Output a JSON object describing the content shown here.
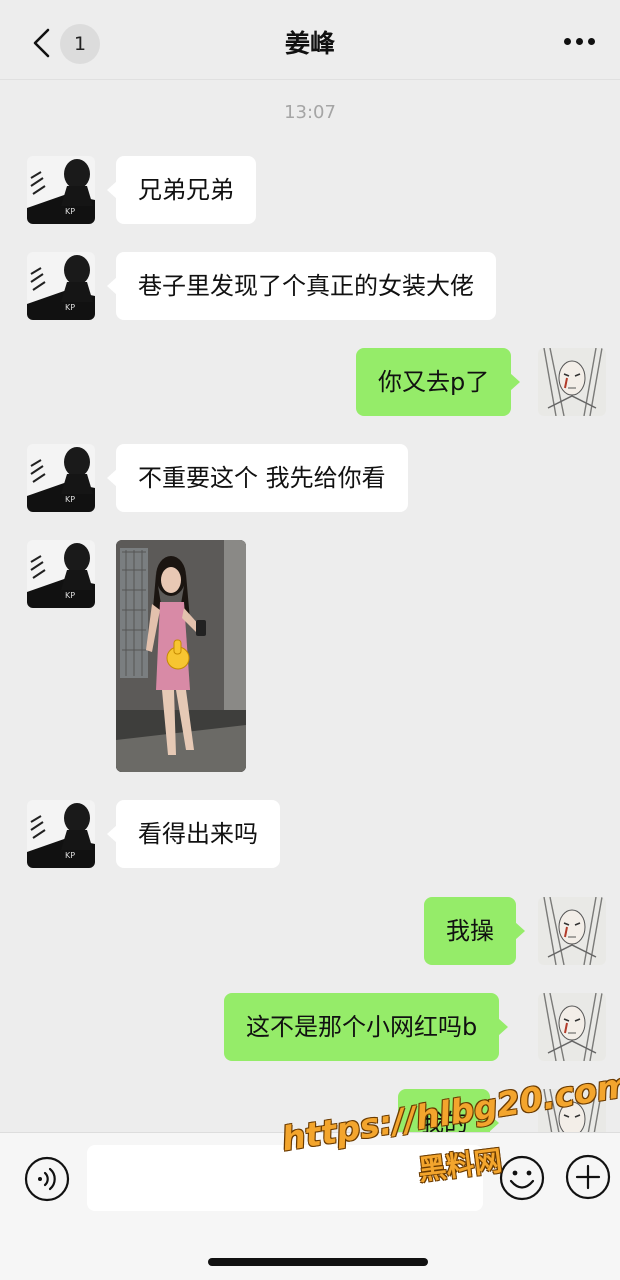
{
  "header": {
    "title": "姜峰",
    "unread_count": "1",
    "back_icon": "chevron-left-icon",
    "more_icon": "more-horizontal-icon"
  },
  "chat": {
    "timestamp": "13:07",
    "messages": [
      {
        "side": "left",
        "type": "text",
        "text": "兄弟兄弟"
      },
      {
        "side": "left",
        "type": "text",
        "text": "巷子里发现了个真正的女装大佬"
      },
      {
        "side": "right",
        "type": "text",
        "text": "你又去p了"
      },
      {
        "side": "left",
        "type": "text",
        "text": "不重要这个 我先给你看"
      },
      {
        "side": "left",
        "type": "image",
        "text": ""
      },
      {
        "side": "left",
        "type": "text",
        "text": "看得出来吗"
      },
      {
        "side": "right",
        "type": "text",
        "text": "我操"
      },
      {
        "side": "right",
        "type": "text",
        "text": "这不是那个小网红吗b"
      },
      {
        "side": "right",
        "type": "text",
        "text": "我的"
      }
    ]
  },
  "input_bar": {
    "voice_icon": "voice-icon",
    "input_value": "",
    "emoji_icon": "emoji-icon",
    "plus_icon": "plus-icon"
  },
  "watermark": {
    "url": "https://hlbg20.com",
    "name": "黑料网"
  },
  "colors": {
    "background": "#ededed",
    "bubble_left": "#ffffff",
    "bubble_right": "#95ec69",
    "watermark": "#f3a52d"
  }
}
